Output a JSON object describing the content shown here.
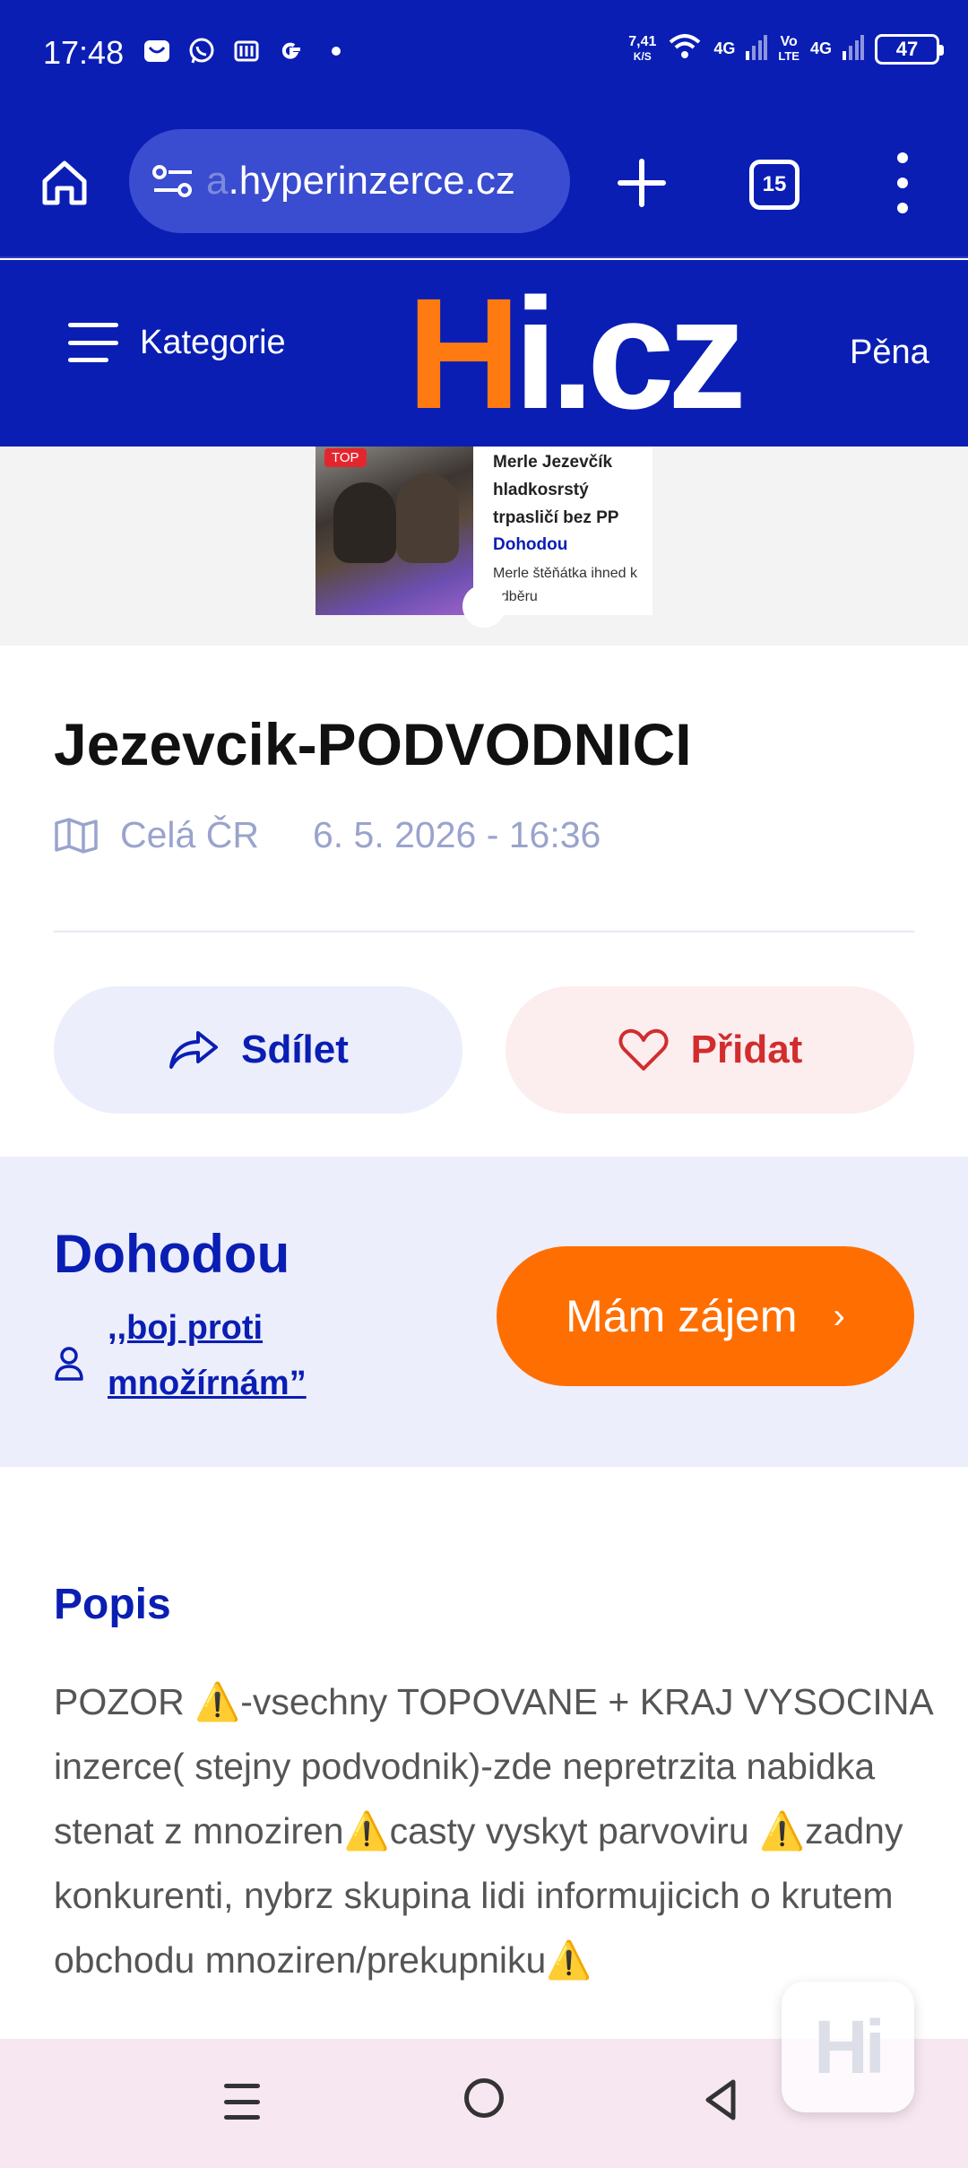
{
  "status_bar": {
    "time": "17:48",
    "speed_value": "7,41",
    "speed_unit": "K/S",
    "net1": "4G",
    "volte_top": "Vo",
    "volte_bottom": "LTE",
    "net2": "4G",
    "battery": "47"
  },
  "browser": {
    "url_fade": "a",
    "url": ".hyperinzerce.cz",
    "tab_count": "15"
  },
  "header": {
    "categories_label": "Kategorie",
    "logo_h": "H",
    "logo_rest": "i.cz",
    "right_label": "Pěna"
  },
  "promo": {
    "badge": "TOP",
    "title": "Merle Jezevčík hladkosrstý trpasličí bez PP",
    "price": "Dohodou",
    "subtitle": "Merle štěňátka ihned k odběru"
  },
  "listing": {
    "title": "Jezevcik-PODVODNICI",
    "location": "Celá ČR",
    "date": "6. 5. 2026 - 16:36",
    "share_label": "Sdílet",
    "add_label": "Přidat"
  },
  "seller": {
    "price": "Dohodou",
    "name": ",,boj proti množírnám”",
    "interest_label": "Mám zájem",
    "interest_chevron": "›"
  },
  "description": {
    "heading": "Popis",
    "text": "POZOR ⚠️-vsechny TOPOVANE + KRAJ VYSOCINA inzerce( stejny podvodnik)-zde nepretrzita nabidka stenat z mnoziren⚠️casty vyskyt parvoviru ⚠️zadny konkurenti, nybrz skupina lidi informujicich o krutem obchodu mnoziren/prekupniku⚠️"
  },
  "fab": {
    "label": "Hi"
  },
  "colors": {
    "brand_blue": "#0a1eb4",
    "brand_orange": "#ff6e00"
  }
}
